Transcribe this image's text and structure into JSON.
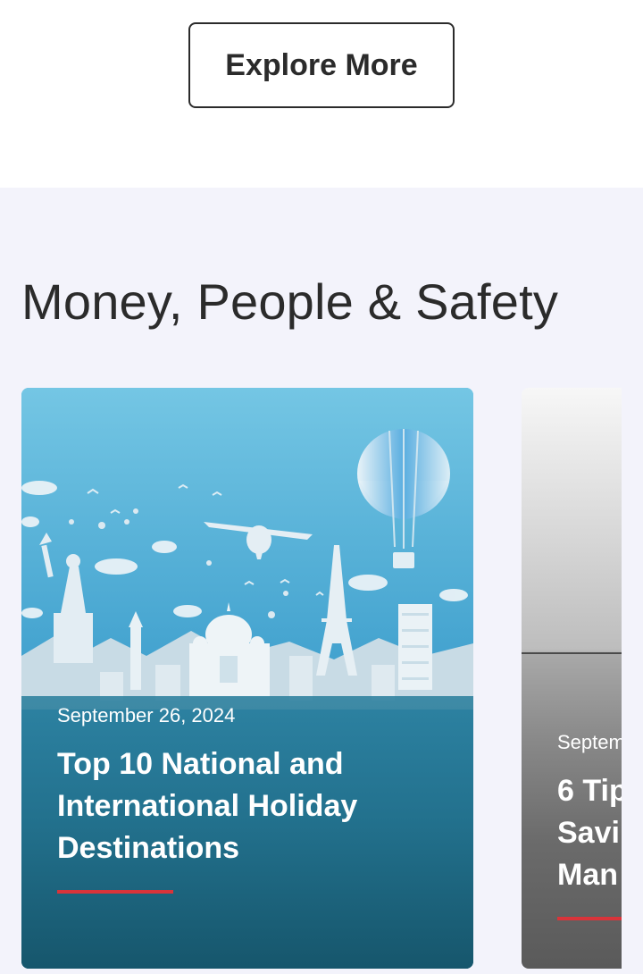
{
  "top": {
    "explore_label": "Explore More"
  },
  "section": {
    "title": "Money, People & Safety"
  },
  "cards": [
    {
      "date": "September 26, 2024",
      "title": "Top 10 National and International Holiday Destinations",
      "image_icon": "travel-landmarks-illustration"
    },
    {
      "date": "Septem",
      "title_lines": [
        "6 Tip",
        "Savi",
        "Man"
      ],
      "image_icon": "grey-gradient-photo"
    }
  ],
  "colors": {
    "accent": "#d9343a",
    "section_bg": "#f3f3fb",
    "text_dark": "#2b2b2b"
  }
}
